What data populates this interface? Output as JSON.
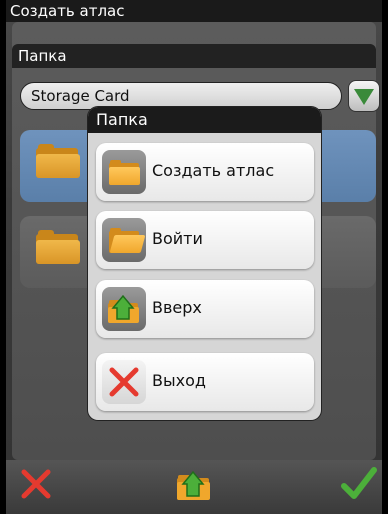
{
  "window": {
    "title": "Создать атлас"
  },
  "section": {
    "header": "Папка"
  },
  "location": {
    "selected": "Storage Card"
  },
  "list": {
    "items": [
      {
        "label": "..",
        "icon": "folder-icon",
        "selected": true
      },
      {
        "label": "..",
        "icon": "folder-icon",
        "selected": false
      }
    ]
  },
  "popup": {
    "title": "Папка",
    "items": [
      {
        "label": "Создать атлас",
        "icon": "folder-icon"
      },
      {
        "label": "Войти",
        "icon": "open-folder-icon"
      },
      {
        "label": "Вверх",
        "icon": "folder-up-icon"
      },
      {
        "label": "Выход",
        "icon": "close-icon"
      }
    ]
  },
  "toolbar": {
    "cancel_icon": "close-icon",
    "up_icon": "folder-up-icon",
    "ok_icon": "checkmark-icon"
  },
  "colors": {
    "selected_row": "#6f93bd",
    "accent_green": "#3a8a3a",
    "cancel_red": "#e53a2f",
    "folder_orange": "#f0a72c"
  }
}
